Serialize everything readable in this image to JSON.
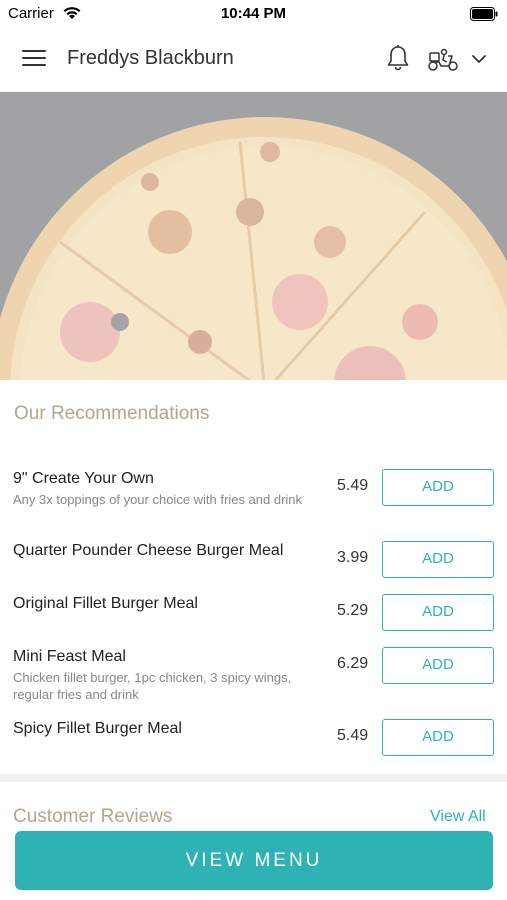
{
  "status_bar": {
    "carrier": "Carrier",
    "time": "10:44 PM",
    "icons": [
      "wifi-icon",
      "battery-icon"
    ]
  },
  "nav": {
    "title": "Freddys Blackburn",
    "icons": [
      "hamburger-menu-icon",
      "bell-icon",
      "scooter-delivery-icon",
      "chevron-down-icon"
    ]
  },
  "hero": {
    "image": "pizza"
  },
  "recommendations": {
    "title": "Our Recommendations",
    "items": [
      {
        "name": "9\" Create Your Own",
        "description": "Any 3x toppings of your choice with fries and drink",
        "price": "5.49",
        "button": "ADD"
      },
      {
        "name": "Quarter Pounder Cheese Burger Meal",
        "description": "",
        "price": "3.99",
        "button": "ADD"
      },
      {
        "name": "Original Fillet Burger Meal",
        "description": "",
        "price": "5.29",
        "button": "ADD"
      },
      {
        "name": "Mini Feast Meal",
        "description": "Chicken fillet burger, 1pc chicken, 3 spicy wings, regular fries and drink",
        "price": "6.29",
        "button": "ADD"
      },
      {
        "name": "Spicy Fillet Burger Meal",
        "description": "",
        "price": "5.49",
        "button": "ADD"
      }
    ]
  },
  "reviews": {
    "title": "Customer Reviews",
    "view_all": "View All"
  },
  "footer": {
    "view_menu": "VIEW MENU"
  },
  "colors": {
    "accent": "#2eb2b3",
    "section_title": "#b5a68b"
  }
}
